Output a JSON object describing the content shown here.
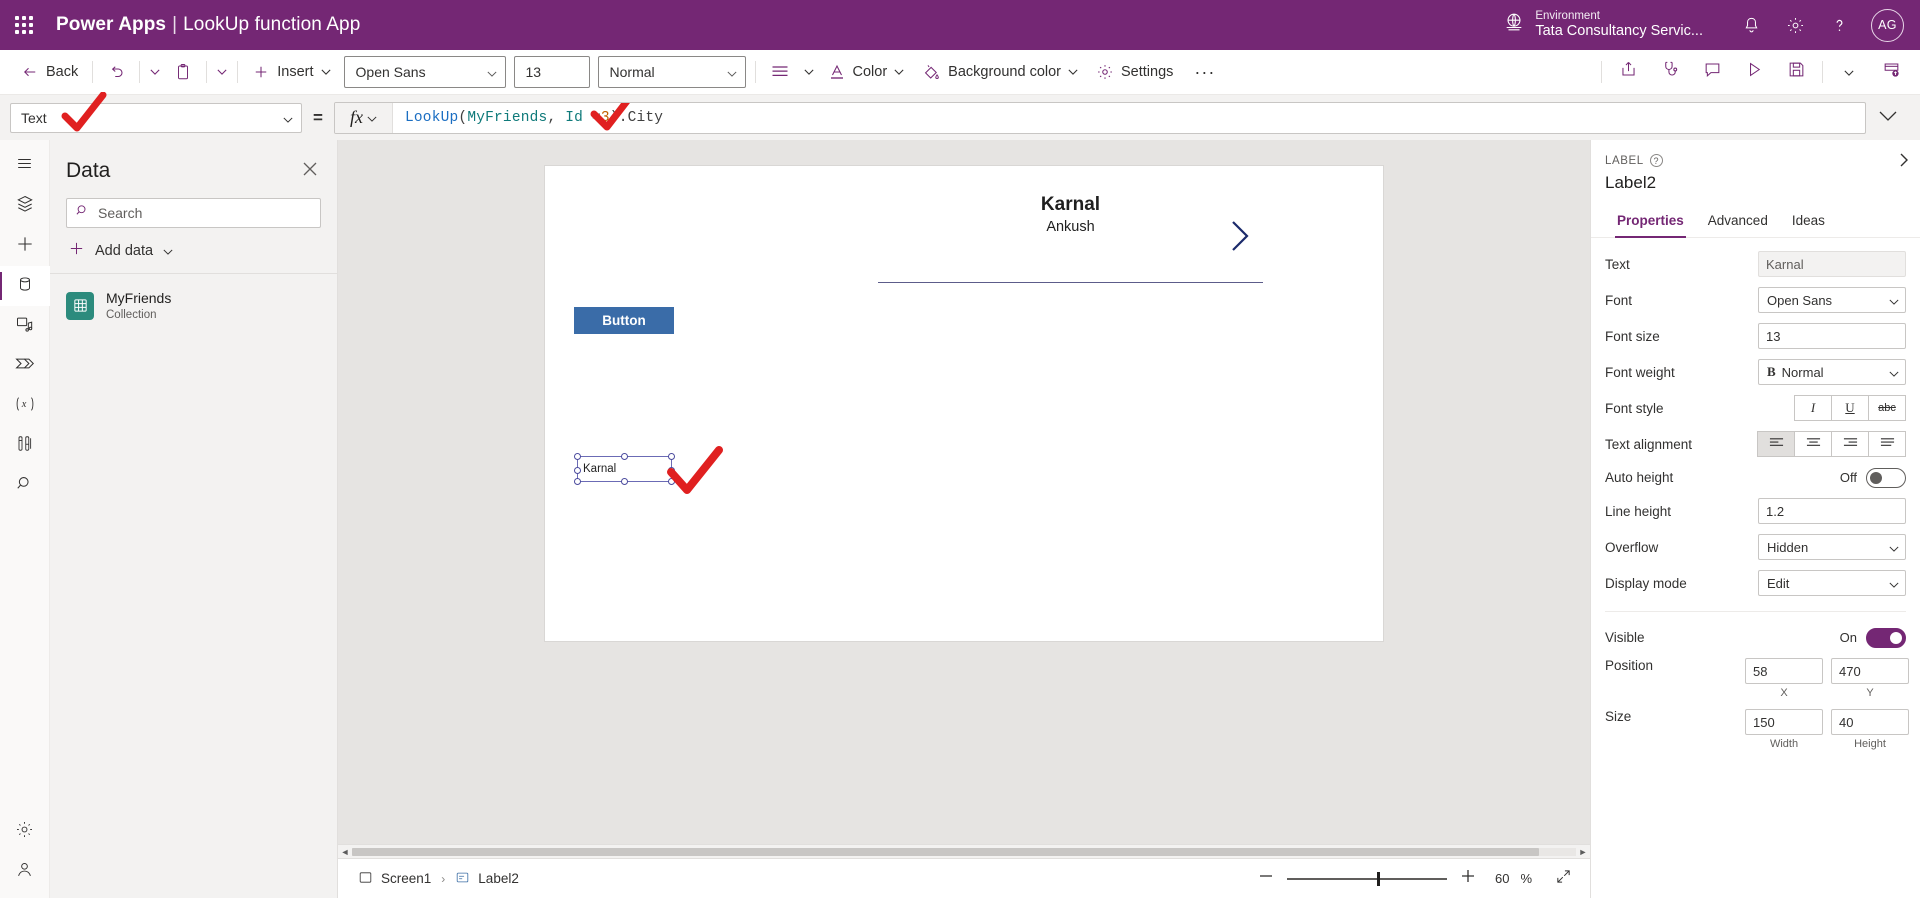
{
  "topbar": {
    "waffle_label": "app-launcher",
    "brand": "Power Apps",
    "separator": "|",
    "app_name": "LookUp function App",
    "environment_label": "Environment",
    "environment_name": "Tata Consultancy Servic...",
    "notifications_icon": "bell-icon",
    "settings_icon": "gear-icon",
    "help_icon": "question-icon",
    "avatar_initials": "AG",
    "bg_color": "#742774"
  },
  "commandbar": {
    "back": "Back",
    "undo_icon": "undo-icon",
    "paste_icon": "paste-icon",
    "insert": "Insert",
    "font_family": "Open Sans",
    "font_size": "13",
    "font_weight": "Normal",
    "align_icon": "align-icon",
    "color": "Color",
    "background_color": "Background color",
    "settings": "Settings",
    "overflow": "···",
    "right_icons": [
      "share-icon",
      "app-checker-icon",
      "comment-icon",
      "play-icon",
      "save-icon",
      "chevron-down-icon",
      "publish-icon"
    ]
  },
  "formulabar": {
    "property": "Text",
    "equals": "=",
    "fx_label": "fx",
    "formula_tokens": [
      {
        "t": "LookUp",
        "c": "fn"
      },
      {
        "t": "(",
        "c": "p"
      },
      {
        "t": "MyFriends",
        "c": "id"
      },
      {
        "t": ", ",
        "c": "op"
      },
      {
        "t": "Id",
        "c": "id"
      },
      {
        "t": " =",
        "c": "op"
      },
      {
        "t": "3",
        "c": "num"
      },
      {
        "t": ")",
        "c": "p"
      },
      {
        "t": ".City",
        "c": "op"
      }
    ],
    "formula_plain": "LookUp(MyFriends, Id =3).City",
    "expand_icon": "chevron-down-icon"
  },
  "rail": {
    "items": [
      {
        "name": "menu-icon",
        "active": false
      },
      {
        "name": "tree-view-icon",
        "active": false
      },
      {
        "name": "insert-icon",
        "active": false
      },
      {
        "name": "data-icon",
        "active": true
      },
      {
        "name": "media-icon",
        "active": false
      },
      {
        "name": "power-automate-icon",
        "active": false
      },
      {
        "name": "variables-icon",
        "active": false
      },
      {
        "name": "app-checker-icon",
        "active": false
      },
      {
        "name": "search-icon",
        "active": false
      }
    ],
    "bottom": [
      {
        "name": "settings-gear-icon"
      },
      {
        "name": "account-icon"
      }
    ]
  },
  "datapanel": {
    "title": "Data",
    "close_icon": "close-icon",
    "search_placeholder": "Search",
    "search_value": "",
    "add_data": "Add data",
    "sources": [
      {
        "name": "MyFriends",
        "type": "Collection",
        "icon": "table-icon",
        "color": "#2c8b7d"
      }
    ]
  },
  "canvas": {
    "gallery_title": "Karnal",
    "gallery_subtitle": "Ankush",
    "chevron_icon": "chevron-right-icon",
    "button_label": "Button",
    "label_text": "Karnal",
    "button_color": "#3a6ca8"
  },
  "bottombar": {
    "screen_name": "Screen1",
    "screen_icon": "screen-icon",
    "control_name": "Label2",
    "control_icon": "label-icon",
    "breadcrumb_separator": "›",
    "zoom_out_icon": "minus-icon",
    "zoom_in_icon": "plus-icon",
    "zoom_value": "60",
    "zoom_unit": "%",
    "fit_icon": "fit-screen-icon"
  },
  "properties": {
    "kind": "LABEL",
    "help_icon": "help-icon",
    "control_name": "Label2",
    "collapse_icon": "chevron-right-icon",
    "tabs": [
      {
        "label": "Properties",
        "active": true
      },
      {
        "label": "Advanced",
        "active": false
      },
      {
        "label": "Ideas",
        "active": false
      }
    ],
    "rows": [
      {
        "label": "Text",
        "value": "Karnal",
        "control": "text-readonly"
      },
      {
        "label": "Font",
        "value": "Open Sans",
        "control": "select"
      },
      {
        "label": "Font size",
        "value": "13",
        "control": "text"
      },
      {
        "label": "Font weight",
        "value": "Normal",
        "control": "select-bold"
      },
      {
        "label": "Font style",
        "control": "segmented",
        "segments": [
          "italic",
          "underline",
          "strikethrough"
        ]
      },
      {
        "label": "Text alignment",
        "control": "segmented-align",
        "segments": [
          "align-left",
          "align-center",
          "align-right",
          "align-justify"
        ],
        "selected": 0
      },
      {
        "label": "Auto height",
        "value": "Off",
        "control": "toggle",
        "on": false
      },
      {
        "label": "Line height",
        "value": "1.2",
        "control": "text"
      },
      {
        "label": "Overflow",
        "value": "Hidden",
        "control": "select"
      },
      {
        "label": "Display mode",
        "value": "Edit",
        "control": "select"
      }
    ],
    "visible": {
      "label": "Visible",
      "state": "On",
      "on": true
    },
    "position": {
      "label": "Position",
      "x": "58",
      "y": "470",
      "x_sub": "X",
      "y_sub": "Y"
    },
    "size": {
      "label": "Size",
      "width": "150",
      "height": "40",
      "width_sub": "Width",
      "height_sub": "Height"
    },
    "accent_color": "#742774"
  }
}
